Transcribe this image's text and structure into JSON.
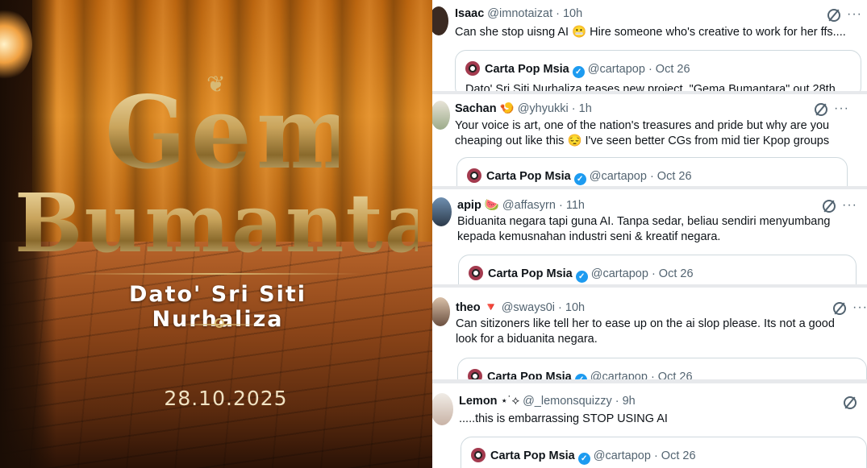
{
  "poster": {
    "title_line1": "Gema",
    "title_line2": "BumantarA",
    "artist": "Dato' Sri Siti Nurhaliza",
    "date": "28.10.2025"
  },
  "quoted": {
    "name": "Carta Pop Msia",
    "handle": "@cartapop",
    "time": "· Oct 26",
    "snippet": "Dato' Sri Siti Nurhaliza teases new project, \"Gema Bumantara\" out 28th"
  },
  "tweets": [
    {
      "name": "Isaac",
      "name_emoji": "",
      "handle": "@imnotaizat",
      "time": "· 10h",
      "text": "Can she stop uisng AI 😬 Hire someone who's creative to work for her ffs...."
    },
    {
      "name": "Sachan",
      "name_emoji": "🍤",
      "handle": "@yhyukki",
      "time": "· 1h",
      "text": "Your voice is art, one of the nation's treasures and pride but why are you cheaping out like this 😔 I've seen better CGs from mid tier Kpop groups"
    },
    {
      "name": "apip",
      "name_emoji": "🍉",
      "handle": "@affasyrn",
      "time": "· 11h",
      "text": "Biduanita negara tapi guna AI. Tanpa sedar, beliau sendiri menyumbang kepada kemusnahan industri seni & kreatif negara."
    },
    {
      "name": "theo",
      "name_emoji": "🔻",
      "handle": "@sways0i",
      "time": "· 10h",
      "text": "Can sitizoners like tell her to ease up on the ai slop please. Its not a good look for a biduanita negara."
    },
    {
      "name": "Lemon",
      "name_emoji": "⋆˙⟡",
      "handle": "@_lemonsquizzy",
      "time": "· 9h",
      "text": ".....this is embarrassing STOP USING AI"
    }
  ],
  "icons": {
    "grok": "grok-icon",
    "more": "more-options-icon",
    "verified": "verified-badge-icon"
  },
  "colors": {
    "verified": "#1d9bf0",
    "muted": "#536471",
    "gold": "#c9a45c"
  }
}
